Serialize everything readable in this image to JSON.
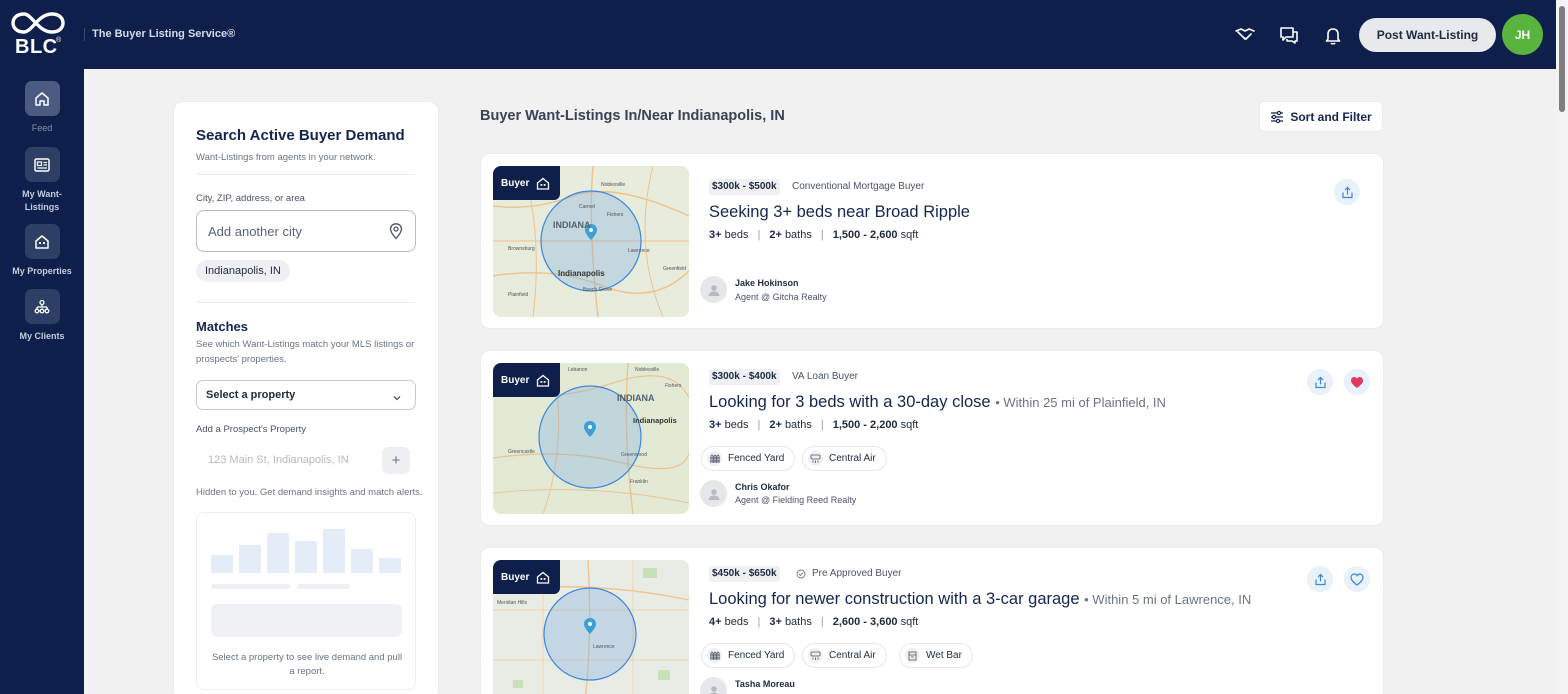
{
  "header": {
    "logo_text": "BLC",
    "tagline": "The Buyer Listing Service®",
    "post_button": "Post Want-Listing",
    "avatar_initials": "JH",
    "accent": "#0f1f4b",
    "avatar_color": "#58b43d"
  },
  "sidebar": {
    "items": [
      {
        "label": "Feed",
        "icon": "home-icon",
        "active": true
      },
      {
        "label": "My Want-Listings",
        "icon": "listing-icon",
        "active": false
      },
      {
        "label": "My Properties",
        "icon": "property-icon",
        "active": false
      },
      {
        "label": "My Clients",
        "icon": "clients-icon",
        "active": false
      }
    ]
  },
  "search_panel": {
    "title": "Search Active Buyer Demand",
    "subtitle": "Want-Listings from agents in your network.",
    "city_label": "City, ZIP, address, or area",
    "city_placeholder": "Add another city",
    "selected_city": "Indianapolis, IN",
    "matches_title": "Matches",
    "matches_desc": "See which Want-Listings match your MLS listings or prospects' properties.",
    "select_value": "Select a property",
    "prospect_label": "Add a Prospect's Property",
    "prospect_placeholder": "123 Main St, Indianapolis, IN",
    "prospect_note": "Hidden to you. Get demand insights and match alerts.",
    "preview_text": "Select a property to see live demand and pull a report."
  },
  "main": {
    "title": "Buyer Want-Listings In/Near Indianapolis, IN",
    "sort_label": "Sort and Filter"
  },
  "listings": [
    {
      "tag": "Buyer",
      "price": "$300k - $500k",
      "loan": "Conventional Mortgage Buyer",
      "title": "Seeking 3+ beds near Broad Ripple",
      "location": "",
      "beds": "3+",
      "beds_label": "beds",
      "baths": "2+",
      "baths_label": "baths",
      "sqft": "1,500 - 2,600",
      "sqft_label": "sqft",
      "amenities": [],
      "agent_name": "Jake Hokinson",
      "agent_company": "Agent @ Gitcha Realty",
      "favorited": null,
      "map_labels": [
        "INDIANA",
        "Indianapolis",
        "Noblesville",
        "Carmel",
        "Fishers",
        "Lawrence",
        "Brownsburg",
        "Greenfield",
        "Plainfield",
        "Beech Grove"
      ]
    },
    {
      "tag": "Buyer",
      "price": "$300k - $400k",
      "loan": "VA Loan Buyer",
      "title": "Looking for 3 beds with a 30-day close",
      "location": "• Within 25 mi of Plainfield, IN",
      "beds": "3+",
      "beds_label": "beds",
      "baths": "2+",
      "baths_label": "baths",
      "sqft": "1,500 - 2,200",
      "sqft_label": "sqft",
      "amenities": [
        "Fenced Yard",
        "Central Air"
      ],
      "agent_name": "Chris Okafor",
      "agent_company": "Agent @ Fielding Reed Realty",
      "favorited": true,
      "map_labels": [
        "INDIANA",
        "Indianapolis",
        "Lebanon",
        "Noblesville",
        "Fishers",
        "Greenwood",
        "Greencastle",
        "Franklin"
      ]
    },
    {
      "tag": "Buyer",
      "price": "$450k - $650k",
      "loan": "Pre Approved Buyer",
      "title": "Looking for newer construction with a 3-car garage",
      "location": "• Within 5 mi of Lawrence, IN",
      "beds": "4+",
      "beds_label": "beds",
      "baths": "3+",
      "baths_label": "baths",
      "sqft": "2,600 - 3,600",
      "sqft_label": "sqft",
      "amenities": [
        "Fenced Yard",
        "Central Air",
        "Wet Bar"
      ],
      "agent_name": "Tasha Moreau",
      "agent_company": "",
      "favorited": false,
      "map_labels": [
        "Meridian Hills",
        "Lawrence"
      ]
    }
  ]
}
